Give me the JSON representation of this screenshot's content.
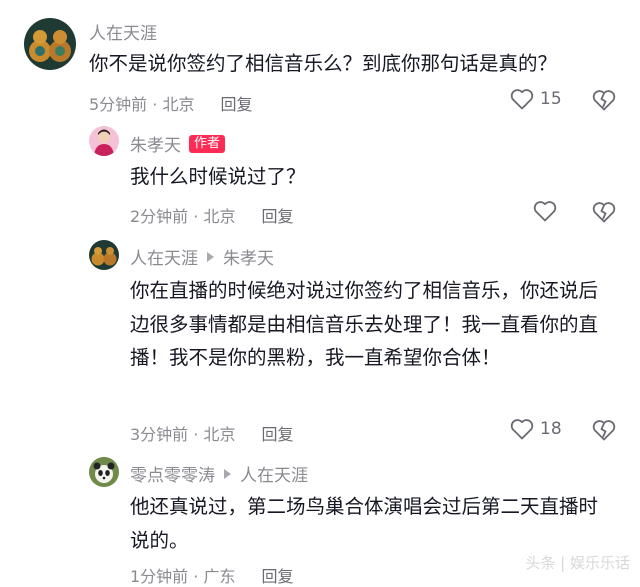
{
  "comments": [
    {
      "user": "人在天涯",
      "text": "你不是说你签约了相信音乐么？到底你那句话是真的？",
      "time": "5分钟前 · 北京",
      "reply": "回复",
      "likes": "15"
    },
    {
      "user": "朱孝天",
      "author_tag": "作者",
      "text": "我什么时候说过了？",
      "time": "2分钟前 · 北京",
      "reply": "回复"
    },
    {
      "user": "人在天涯",
      "reply_to": "朱孝天",
      "text": "你在直播的时候绝对说过你签约了相信音乐，你还说后边很多事情都是由相信音乐去处理了！我一直看你的直播！我不是你的黑粉，我一直希望你合体！",
      "time": "3分钟前 · 北京",
      "reply": "回复",
      "likes": "18"
    },
    {
      "user": "零点零零涛",
      "reply_to": "人在天涯",
      "text": "他还真说过，第二场鸟巢合体演唱会过后第二天直播时说的。",
      "time": "1分钟前 · 广东",
      "reply": "回复"
    }
  ],
  "watermark": "头条 | 娱乐乐话"
}
